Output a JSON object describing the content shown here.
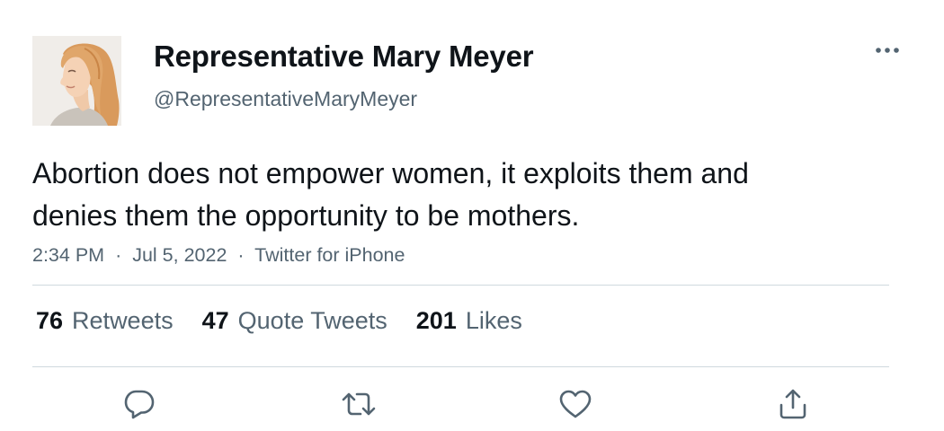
{
  "author": {
    "display_name": "Representative Mary Meyer",
    "handle": "@RepresentativeMaryMeyer"
  },
  "tweet": {
    "text_lines": [
      "Abortion does not empower women, it exploits them and",
      "denies them the opportunity to be mothers."
    ],
    "time": "2:34 PM",
    "separator": "·",
    "date": "Jul 5, 2022",
    "source": "Twitter for iPhone"
  },
  "stats": {
    "retweets": {
      "count": "76",
      "label": "Retweets"
    },
    "quote_tweets": {
      "count": "47",
      "label": "Quote Tweets"
    },
    "likes": {
      "count": "201",
      "label": "Likes"
    }
  },
  "icons": {
    "more": "more-horizontal-icon",
    "reply": "reply-icon",
    "retweet": "retweet-icon",
    "like": "heart-icon",
    "share": "share-icon"
  },
  "colors": {
    "text_primary": "#0f1419",
    "text_secondary": "#536471",
    "divider": "#cfd9de"
  }
}
